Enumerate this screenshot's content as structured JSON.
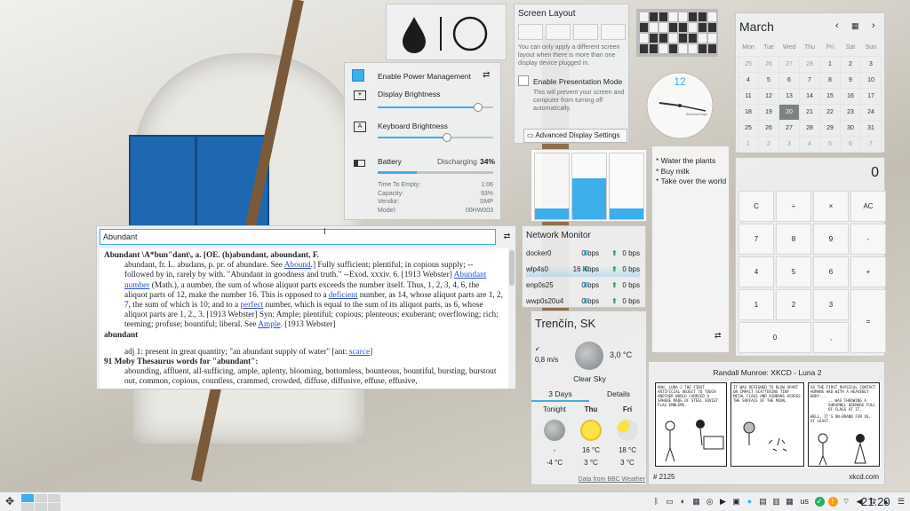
{
  "power": {
    "enable_label": "Enable Power Management",
    "display_brightness": "Display Brightness",
    "display_level": 0.87,
    "keyboard_brightness": "Keyboard Brightness",
    "keyboard_level": 0.6,
    "battery_label": "Battery",
    "battery_state": "Discharging",
    "battery_pct": "34%",
    "battery_level": 0.34,
    "details": [
      [
        "Time To Empty:",
        "1:06"
      ],
      [
        "Capacity:",
        "93%"
      ],
      [
        "Vendor:",
        "SMP"
      ],
      [
        "Model:",
        "00HW003"
      ]
    ]
  },
  "screen_layout": {
    "title": "Screen Layout",
    "info": "You can only apply a different screen layout when there is more than one display device plugged in.",
    "presentation_label": "Enable Presentation Mode",
    "presentation_desc": "This will prevent your screen and computer from turning off automatically.",
    "advanced_button": "Advanced Display Settings"
  },
  "calendar": {
    "month": "March",
    "weekdays": [
      "Mon",
      "Tue",
      "Wed",
      "Thu",
      "Fri",
      "Sat",
      "Sun"
    ],
    "weeks": [
      [
        "25",
        "26",
        "27",
        "28",
        "1",
        "2",
        "3"
      ],
      [
        "4",
        "5",
        "6",
        "7",
        "8",
        "9",
        "10"
      ],
      [
        "11",
        "12",
        "13",
        "14",
        "15",
        "16",
        "17"
      ],
      [
        "18",
        "19",
        "20",
        "21",
        "22",
        "23",
        "24"
      ],
      [
        "25",
        "26",
        "27",
        "28",
        "29",
        "30",
        "31"
      ],
      [
        "1",
        "2",
        "3",
        "4",
        "5",
        "6",
        "7"
      ]
    ],
    "today": "20"
  },
  "clock": {
    "number": "12",
    "brand": "Elements Dope"
  },
  "notes": {
    "lines": [
      "* Water the plants",
      "* Buy milk",
      "* Take over the world"
    ]
  },
  "calculator": {
    "display": "0",
    "rows": [
      [
        "C",
        "÷",
        "×",
        "AC"
      ],
      [
        "7",
        "8",
        "9",
        "-"
      ],
      [
        "4",
        "5",
        "6",
        "+"
      ],
      [
        "1",
        "2",
        "3",
        "="
      ],
      [
        "0",
        ","
      ]
    ]
  },
  "krunner": {
    "query": "Abundant"
  },
  "dict": {
    "heading": "Abundant \\A*bun\"dant\\, a. [OE. (h)abundant, aboundant, F.",
    "p1a": "abundant, fr. L. abudans, p. pr. of abundare. See ",
    "p1_link": "Abound",
    "p1b": ".] Fully sufficient; plentiful; in copious supply; -- followed by in, rarely by with. \"Abundant in goodness and truth.\" --Exod. xxxiv. 6. [1913 Webster] ",
    "p1_link2": "Abundant number",
    "p1c": " (Math.), a number, the sum of whose aliquot parts exceeds the number itself. Thus, 1, 2, 3, 4, 6, the aliquot parts of 12, make the number 16. This is opposed to a ",
    "p1_link3": "deficient",
    "p1d": " number, as 14, whose aliquot parts are 1, 2, 7, the sum of which is 10; and to a ",
    "p1_link4": "perfect",
    "p1e": " number, which is equal to the sum of its aliquot parts, as 6, whose aliquot parts are 1, 2., 3. [1913 Webster] Syn: Ample; plentiful; copious; plenteous; exuberant; overflowing; rich; teeming; profuse; bountiful; liberal. See ",
    "p1_link5": "Ample",
    "p1f": ". [1913 Webster]",
    "word2": "abundant",
    "adj": "adj 1: present in great quantity; \"an abundant supply of water\" [ant: ",
    "adj_link": "scarce",
    "adj_end": "]",
    "moby": "91 Moby Thesaurus words for \"abundant\":",
    "moby_words": "abounding, affluent, all-sufficing, ample, aplenty, blooming, bottomless, bounteous, bountiful, bursting, burstout out, common, copious, countless, crammed, crowded, diffuse, diffusive, effuse, effusive,"
  },
  "network": {
    "title": "Network Monitor",
    "rows": [
      {
        "name": "docker0",
        "down": "0 bps",
        "up": "0 bps"
      },
      {
        "name": "wlp4s0",
        "down": "16 Kbps",
        "up": "0 bps"
      },
      {
        "name": "enp0s25",
        "down": "0 bps",
        "up": "0 bps"
      },
      {
        "name": "wwp0s20u4",
        "down": "0 bps",
        "up": "0 bps"
      }
    ]
  },
  "weather": {
    "city": "Trenčín, SK",
    "wind": "0,8 m/s",
    "temp": "3,0 °C",
    "condition": "Clear Sky",
    "tab_days": "3 Days",
    "tab_details": "Details",
    "days": [
      {
        "name": "Tonight",
        "high": "-",
        "low": "-4 °C"
      },
      {
        "name": "Thu",
        "high": "16 °C",
        "low": "3 °C"
      },
      {
        "name": "Fri",
        "high": "18 °C",
        "low": "3 °C"
      }
    ],
    "source": "Data from BBC Weather"
  },
  "xkcd": {
    "title": "Randall Munroe: XKCD - Luna 2",
    "number": "# 2125",
    "site": "xkcd.com",
    "p1": "HUH, LUNA 2 THE FIRST ARTIFICIAL OBJECT TO TOUCH ANOTHER WORLD CARRIED A SPHERE MADE OF STEEL SOVIET FLAG EMBLEMS.",
    "p2": "IT WAS DESIGNED TO BLOW APART ON IMPACT SCATTERING TINY METAL FLAGS AND RIBBONS ACROSS THE SURFACE OF THE MOON.",
    "p3a": "SO THE FIRST PHYSICAL CONTACT HUMANS HAD WITH A HEAVENLY BODY...",
    "p3b": "...WAS THROWING A SHRAPNEL GRENADE FULL OF FLAGS AT IT.",
    "p3c": "WELL, IT'S ON-BRAND FOR US, AT LEAST."
  },
  "panel": {
    "time": "21:20",
    "keyboard": "us"
  },
  "colors": {
    "accent": "#3daee9",
    "door": "#1d68b0",
    "today": "#7e8285"
  }
}
